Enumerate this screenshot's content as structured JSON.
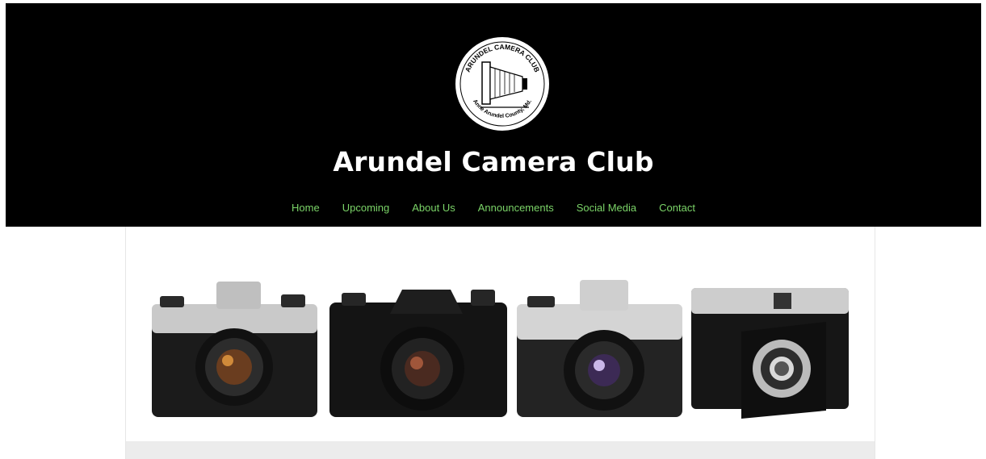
{
  "site": {
    "title": "Arundel Camera Club",
    "logo_top_text": "ARUNDEL CAMERA CLUB",
    "logo_bottom_text": "Anne Arundel County, Md."
  },
  "nav": {
    "items": [
      "Home",
      "Upcoming",
      "About Us",
      "Announcements",
      "Social Media",
      "Contact"
    ]
  },
  "colors": {
    "header_bg": "#000000",
    "nav_link": "#7bd468",
    "title_text": "#ffffff"
  },
  "banner": {
    "icon": "cameras-banner-image"
  }
}
